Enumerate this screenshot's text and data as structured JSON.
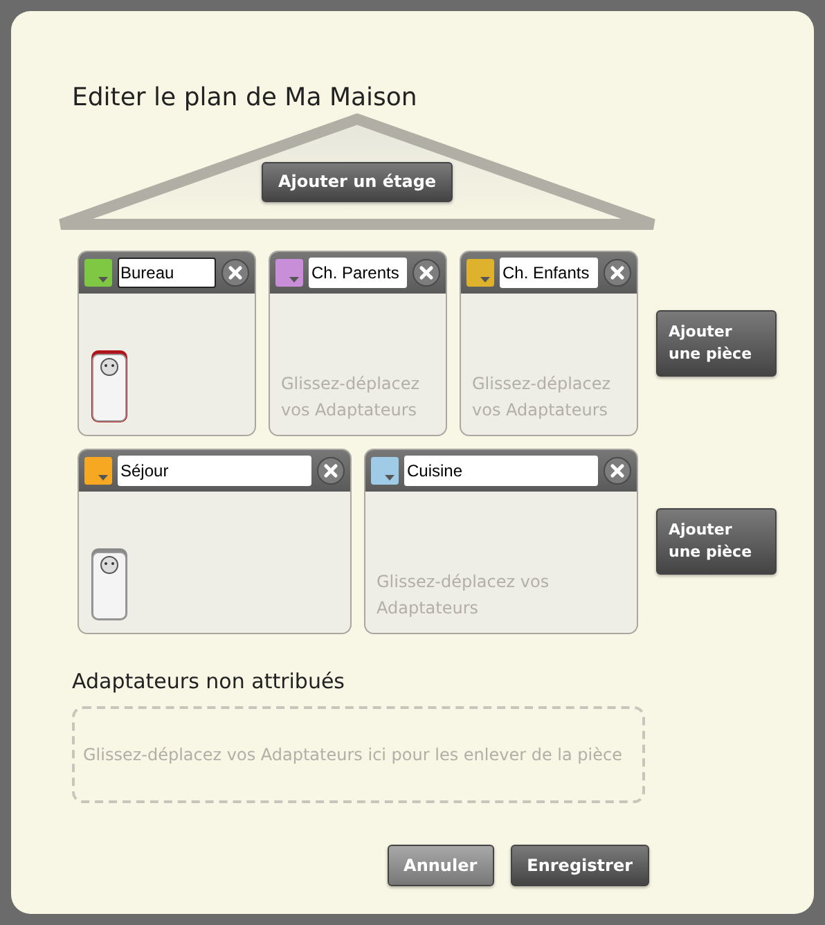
{
  "dialog": {
    "title": "Editer le plan de Ma Maison",
    "add_floor": "Ajouter un étage"
  },
  "floors": [
    {
      "add_room": "Ajouter une pièce",
      "rooms": [
        {
          "name": "Bureau",
          "color": "#7ec843",
          "focused": true,
          "adapters": [
            {
              "color": "#b0141c"
            }
          ]
        },
        {
          "name": "Ch. Parents",
          "color": "#c88fd8",
          "focused": false,
          "hint": "Glissez-déplacez vos Adaptateurs"
        },
        {
          "name": "Ch. Enfants",
          "color": "#dfb22e",
          "focused": false,
          "hint": "Glissez-déplacez vos Adaptateurs"
        }
      ]
    },
    {
      "add_room": "Ajouter une pièce",
      "rooms": [
        {
          "name": "Séjour",
          "color": "#f7a823",
          "focused": false,
          "adapters": [
            {
              "color": "#8a8a8a"
            }
          ]
        },
        {
          "name": "Cuisine",
          "color": "#9fcbe6",
          "focused": false,
          "hint": "Glissez-déplacez vos Adaptateurs"
        }
      ]
    }
  ],
  "unassigned": {
    "title": "Adaptateurs non attribués",
    "hint": "Glissez-déplacez vos Adaptateurs ici pour les enlever de la pièce"
  },
  "buttons": [
    {
      "label": "Annuler",
      "kind": "secondary"
    },
    {
      "label": "Enregistrer",
      "kind": "primary"
    }
  ]
}
